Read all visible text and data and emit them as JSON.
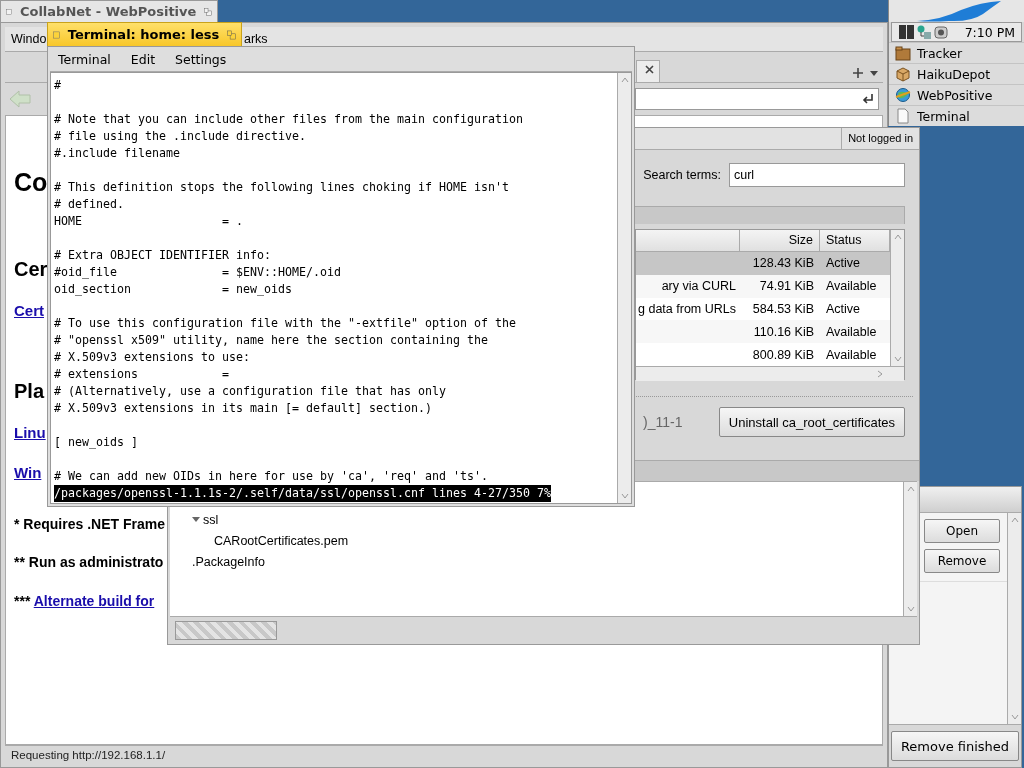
{
  "browser": {
    "title": "CollabNet - WebPositive",
    "active": false,
    "menus": [
      "Windo",
      "arks"
    ],
    "page": [
      {
        "kind": "h1",
        "text": "Co"
      },
      {
        "kind": "h2",
        "text": "Cer"
      },
      {
        "kind": "link",
        "text": "Cert"
      },
      {
        "kind": "h2",
        "text": "Pla"
      },
      {
        "kind": "link",
        "text": "Linu"
      },
      {
        "kind": "link",
        "text": "Win"
      },
      {
        "kind": "note",
        "text": "* Requires .NET Frame"
      },
      {
        "kind": "note",
        "text": "** Run as administrato"
      },
      {
        "kind": "note",
        "text": "*** ",
        "link": "Alternate build for"
      }
    ],
    "status": "Requesting http://192.168.1.1/"
  },
  "downloads": {
    "buttons": [
      "Open",
      "Remove"
    ],
    "clear": "Remove finished"
  },
  "depot": {
    "account": "Not logged in",
    "search_label": "Search terms:",
    "search_value": "curl",
    "columns": [
      "Size",
      "Status"
    ],
    "packages": [
      {
        "size": "128.43 KiB",
        "status": "Active",
        "selected": true
      },
      {
        "description": "ary via CURL",
        "size": "74.91 KiB",
        "status": "Available",
        "selected": false
      },
      {
        "description": "g data from URLs",
        "size": "584.53 KiB",
        "status": "Active",
        "selected": false
      },
      {
        "size": "110.16 KiB",
        "status": "Available",
        "selected": false
      },
      {
        "size": "800.89 KiB",
        "status": "Available",
        "selected": false
      }
    ],
    "version": ")_11-1",
    "action": "Uninstall ca_root_certificates",
    "files": [
      {
        "label": "ssl",
        "expanded": true,
        "children": [
          {
            "label": "CARootCertificates.pem"
          }
        ]
      },
      {
        "label": ".PackageInfo"
      }
    ]
  },
  "terminal": {
    "title": "Terminal: home: less",
    "active": true,
    "menus": [
      "Terminal",
      "Edit",
      "Settings"
    ],
    "text": "#\n\n# Note that you can include other files from the main configuration\n# file using the .include directive.\n#.include filename\n\n# This definition stops the following lines choking if HOME isn't\n# defined.\nHOME                    = .\n\n# Extra OBJECT IDENTIFIER info:\n#oid_file               = $ENV::HOME/.oid\noid_section             = new_oids\n\n# To use this configuration file with the \"-extfile\" option of the\n# \"openssl x509\" utility, name here the section containing the\n# X.509v3 extensions to use:\n# extensions            =\n# (Alternatively, use a configuration file that has only\n# X.509v3 extensions in its main [= default] section.)\n\n[ new_oids ]\n\n# We can add new OIDs in here for use by 'ca', 'req' and 'ts'.",
    "status": "/packages/openssl-1.1.1s-2/.self/data/ssl/openssl.cnf lines 4-27/350 7%"
  },
  "deskbar": {
    "clock": "7:10 PM",
    "apps": [
      {
        "label": "Tracker",
        "kind": "tracker"
      },
      {
        "label": "HaikuDepot",
        "kind": "depot"
      },
      {
        "label": "WebPositive",
        "kind": "browser"
      },
      {
        "label": "Terminal",
        "kind": "terminal"
      }
    ]
  }
}
